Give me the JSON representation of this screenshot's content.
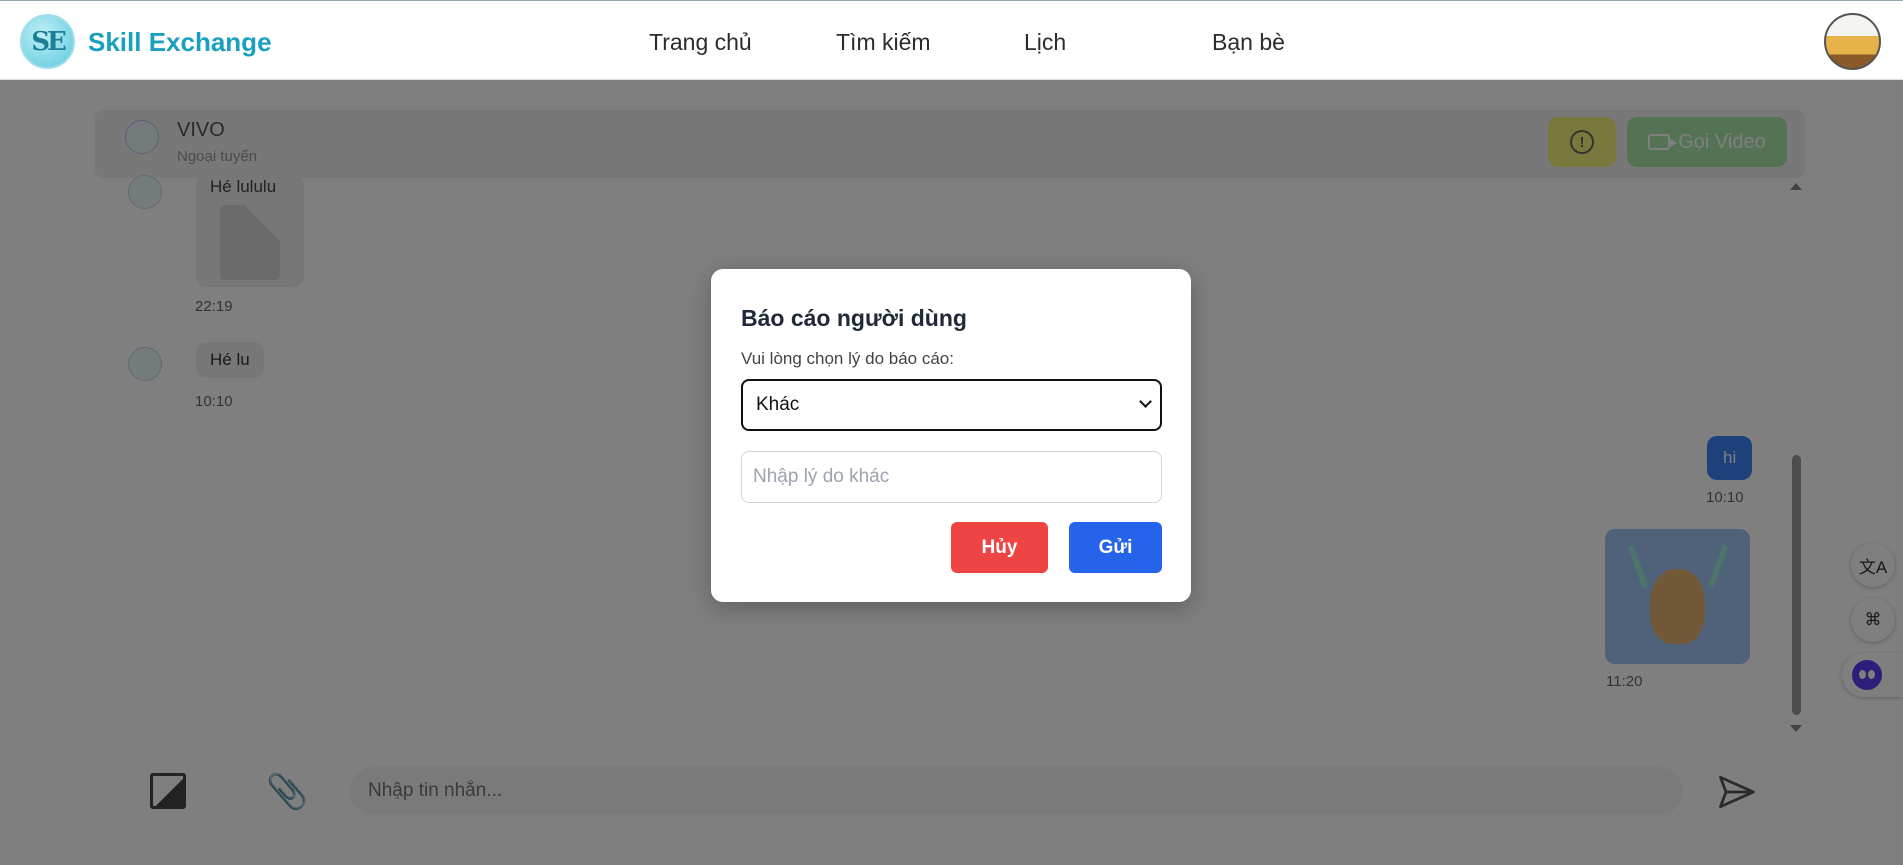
{
  "header": {
    "logo_text": "SE",
    "brand": "Skill Exchange",
    "nav": [
      "Trang chủ",
      "Tìm kiếm",
      "Lịch",
      "Bạn bè"
    ]
  },
  "chat": {
    "contact_name": "VIVO",
    "contact_status": "Ngoại tuyến",
    "video_button": "Gọi Video",
    "messages": [
      {
        "side": "in",
        "text": "Hé lululu",
        "attachment": "pdf-icon",
        "time": "22:19"
      },
      {
        "side": "in",
        "text": "Hé lu",
        "time": "10:10"
      },
      {
        "side": "out",
        "text": "hi",
        "time": "10:10"
      },
      {
        "side": "out",
        "sticker": "doge-sticker",
        "time": "11:20"
      }
    ],
    "composer_placeholder": "Nhập tin nhắn..."
  },
  "floating": {
    "translate_icon": "translate-icon",
    "apps_icon": "apps-icon",
    "assistant_icon": "assistant-icon"
  },
  "modal": {
    "title": "Báo cáo người dùng",
    "label": "Vui lòng chọn lý do báo cáo:",
    "selected_reason": "Khác",
    "other_placeholder": "Nhập lý do khác",
    "cancel_label": "Hủy",
    "send_label": "Gửi"
  },
  "colors": {
    "brand": "#1aa0bf",
    "cancel": "#ef4444",
    "send": "#2563eb",
    "outgoing_bubble": "#3b82f6",
    "overlay": "rgba(0,0,0,0.5)"
  }
}
